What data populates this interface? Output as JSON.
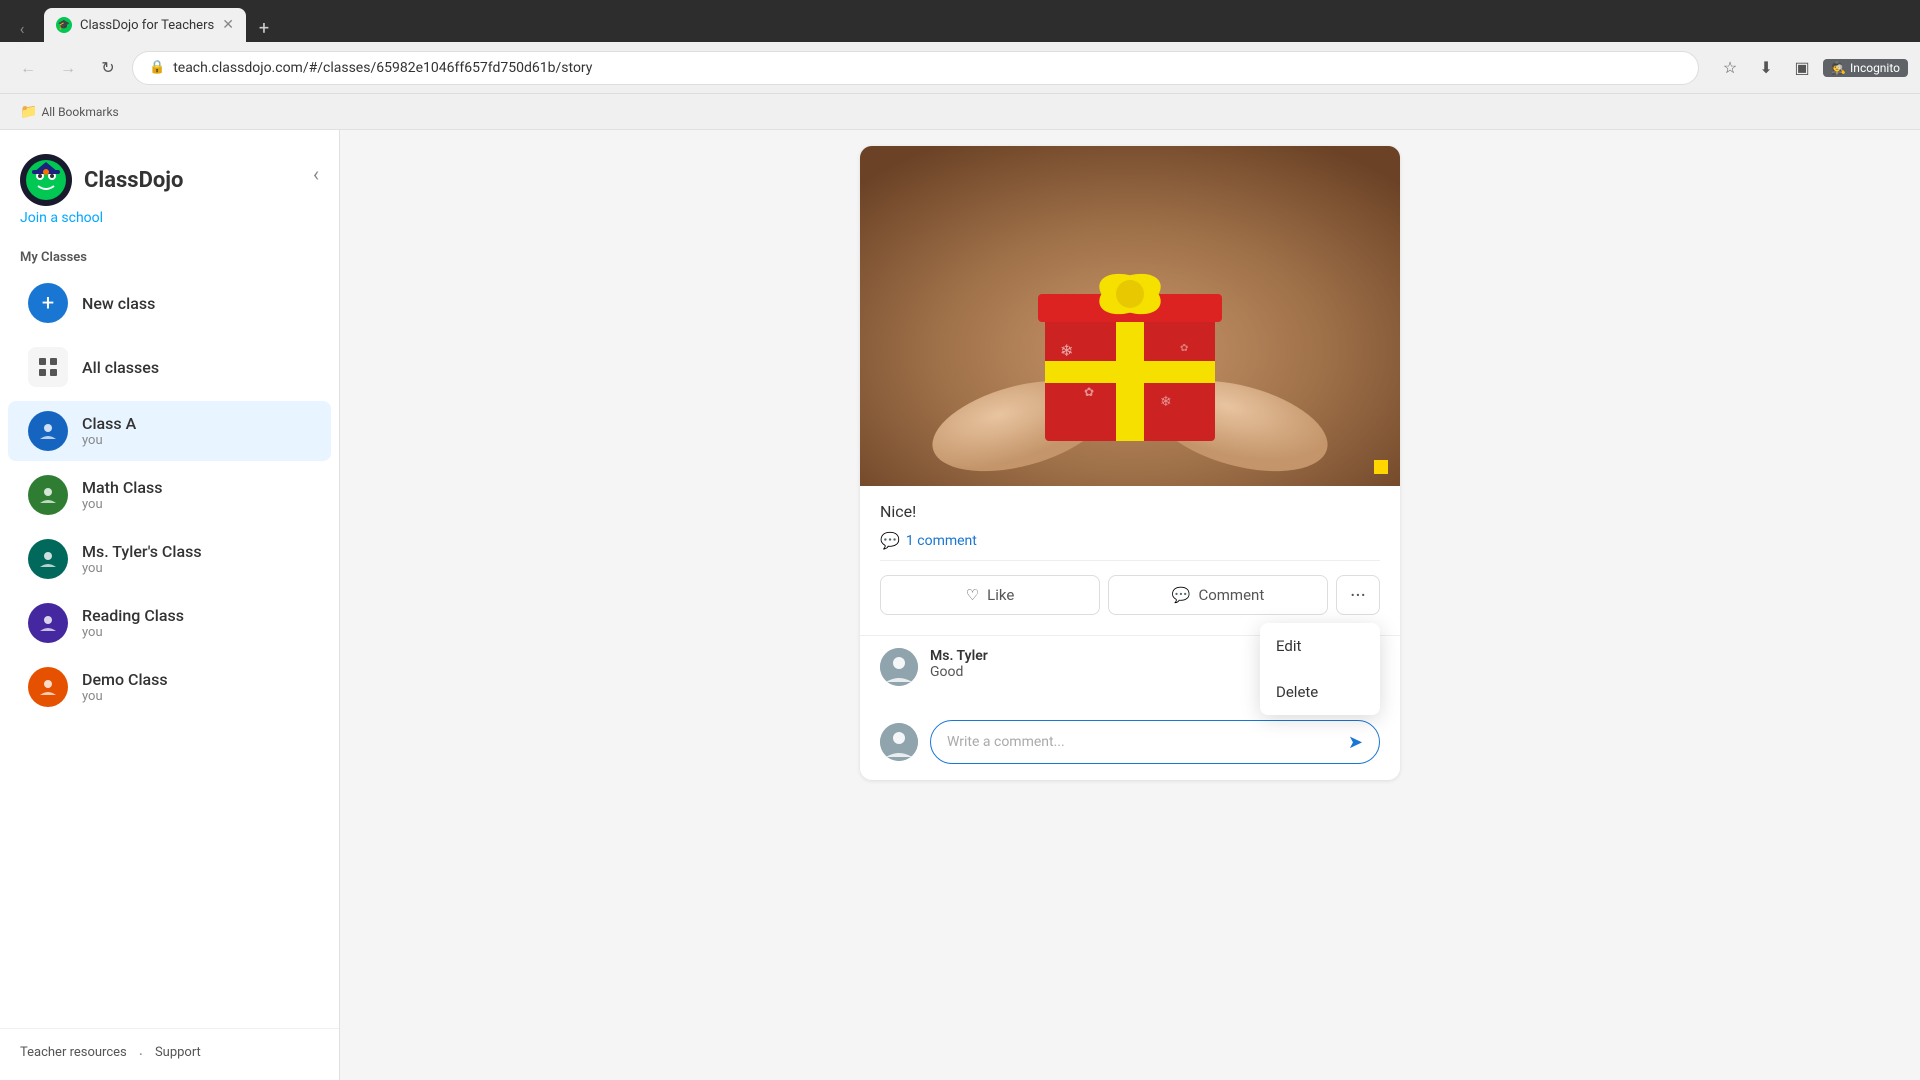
{
  "browser": {
    "tabs": [
      {
        "id": "classdojo",
        "label": "ClassDojo for Teachers",
        "active": true,
        "favicon": "🎓"
      }
    ],
    "new_tab_label": "+",
    "address": "teach.classdojo.com/#/classes/65982e1046ff657fd750d61b/story",
    "incognito_label": "Incognito",
    "bookmarks_label": "All Bookmarks"
  },
  "sidebar": {
    "app_name": "ClassDojo",
    "join_school": "Join a school",
    "my_classes_label": "My Classes",
    "new_class_label": "New class",
    "all_classes_label": "All classes",
    "classes": [
      {
        "id": "class-a",
        "name": "Class A",
        "sub": "you",
        "active": true
      },
      {
        "id": "math-class",
        "name": "Math Class",
        "sub": "you",
        "active": false
      },
      {
        "id": "ms-tyler",
        "name": "Ms. Tyler's Class",
        "sub": "you",
        "active": false
      },
      {
        "id": "reading-class",
        "name": "Reading Class",
        "sub": "you",
        "active": false
      },
      {
        "id": "demo-class",
        "name": "Demo Class",
        "sub": "you",
        "active": false
      }
    ],
    "footer": {
      "teacher_resources": "Teacher resources",
      "support": "Support"
    }
  },
  "post": {
    "caption": "Nice!",
    "comment_count": "1 comment",
    "like_label": "Like",
    "comment_label": "Comment",
    "context_menu": {
      "edit": "Edit",
      "delete": "Delete"
    },
    "comment": {
      "author": "Ms. Tyler",
      "text": "Good"
    },
    "write_comment_placeholder": "Write a comment..."
  }
}
